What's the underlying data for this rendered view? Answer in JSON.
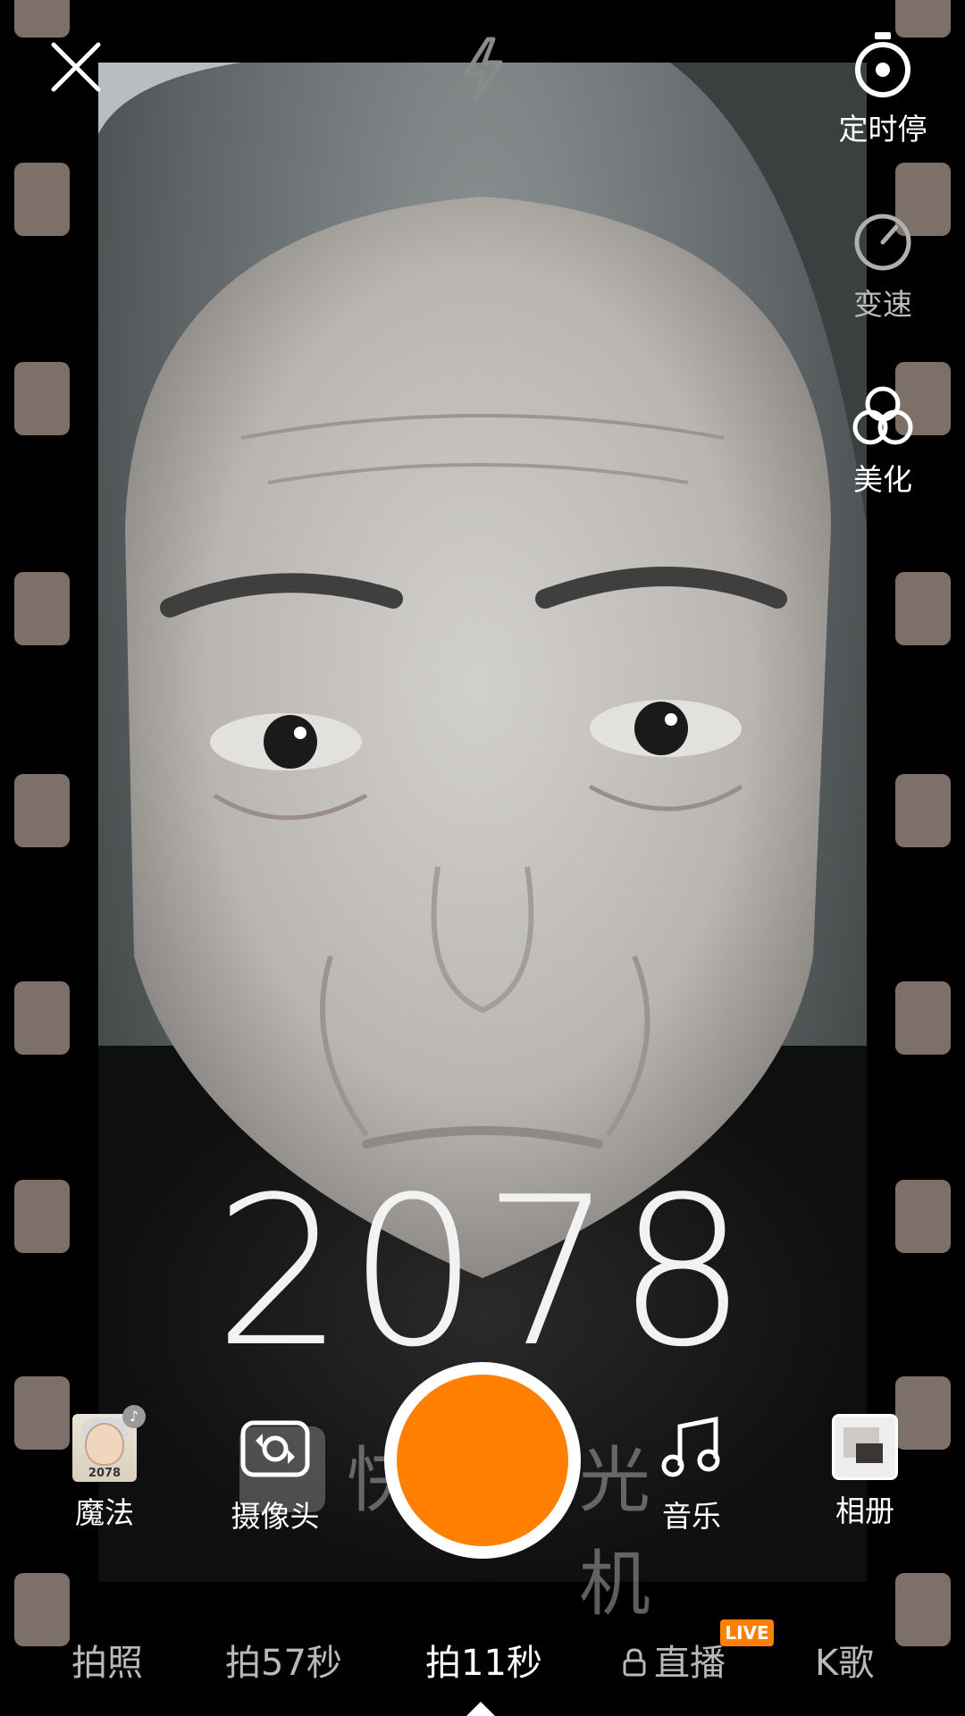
{
  "overlay": {
    "year": "2078"
  },
  "top": {
    "close_icon": "close-icon",
    "flash_icon": "flash-icon"
  },
  "side_menu": {
    "timer": {
      "label": "定时停",
      "icon": "stopwatch-icon"
    },
    "speed": {
      "label": "变速",
      "icon": "speedometer-icon"
    },
    "beauty": {
      "label": "美化",
      "icon": "beauty-circles-icon"
    }
  },
  "bottom_controls": {
    "magic": {
      "label": "魔法",
      "thumb_text": "2078"
    },
    "camera_switch": {
      "label": "摄像头"
    },
    "music": {
      "label": "音乐"
    },
    "album": {
      "label": "相册"
    }
  },
  "watermark": {
    "part1": "快",
    "part2": "光机"
  },
  "modes": {
    "items": [
      "拍照",
      "拍57秒",
      "拍11秒",
      "直播",
      "K歌"
    ],
    "active": "拍11秒",
    "live_badge": "LIVE"
  },
  "colors": {
    "accent": "#ff8000",
    "film_hole": "#7d7068"
  }
}
